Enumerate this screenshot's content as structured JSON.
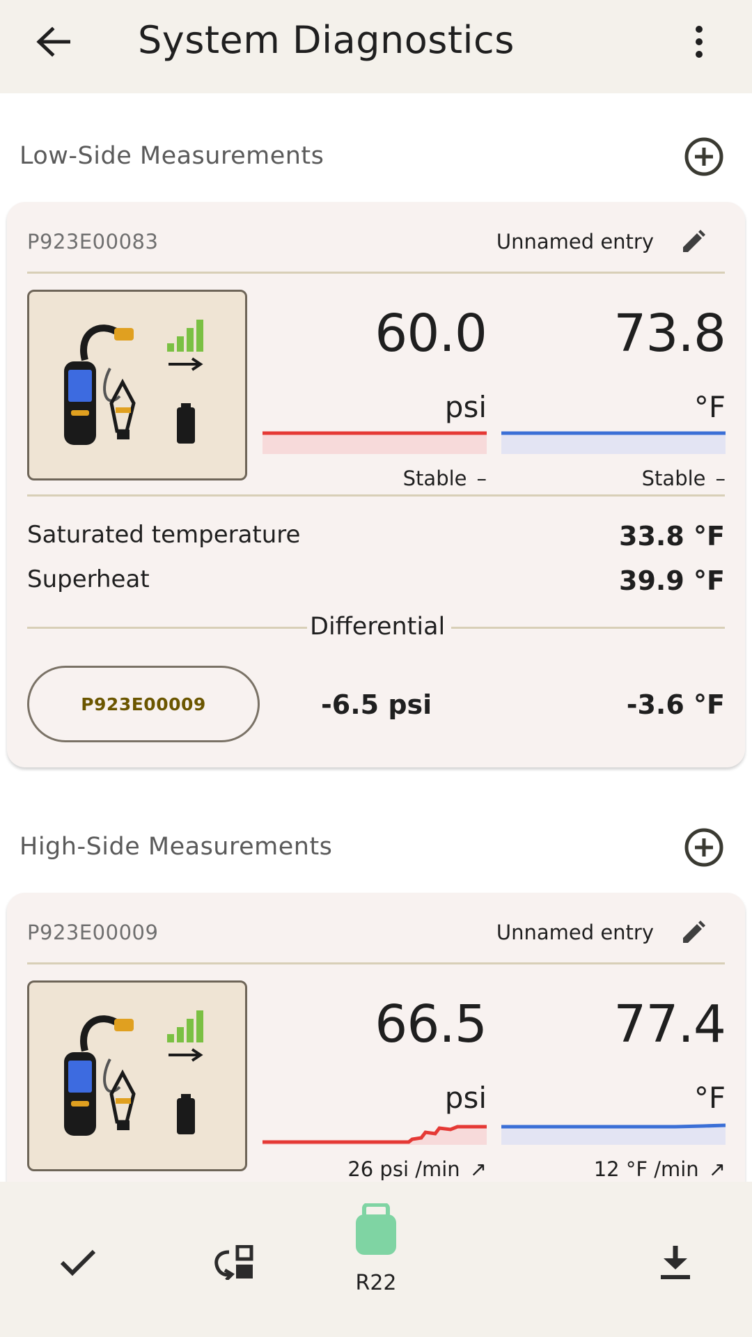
{
  "appbar": {
    "title": "System Diagnostics",
    "back_icon": "arrow-left-icon",
    "menu_icon": "more-vertical-icon"
  },
  "low": {
    "section_title": "Low-Side Measurements",
    "serial": "P923E00083",
    "entry_name": "Unnamed entry",
    "pressure": {
      "value": "60.0",
      "unit": "psi",
      "trend": "Stable",
      "trend_symbol": "–",
      "color": "#e53935"
    },
    "temperature": {
      "value": "73.8",
      "unit": "°F",
      "trend": "Stable",
      "trend_symbol": "–",
      "color": "#3b6fd6"
    },
    "saturated_label": "Saturated temperature",
    "saturated_value": "33.8 °F",
    "superheat_label": "Superheat",
    "superheat_value": "39.9 °F",
    "differential_label": "Differential",
    "reference_serial": "P923E00009",
    "diff_pressure": "-6.5 psi",
    "diff_temperature": "-3.6 °F"
  },
  "high": {
    "section_title": "High-Side Measurements",
    "serial": "P923E00009",
    "entry_name": "Unnamed entry",
    "pressure": {
      "value": "66.5",
      "unit": "psi",
      "trend": "26 psi /min",
      "trend_symbol": "↗",
      "color": "#e53935"
    },
    "temperature": {
      "value": "77.4",
      "unit": "°F",
      "trend": "12 °F /min",
      "trend_symbol": "↗",
      "color": "#3b6fd6"
    }
  },
  "bottombar": {
    "refrigerant": "R22",
    "refrigerant_color": "#7fd4a3",
    "check_icon": "check-icon",
    "swap_icon": "swap-device-icon",
    "download_icon": "download-icon"
  }
}
